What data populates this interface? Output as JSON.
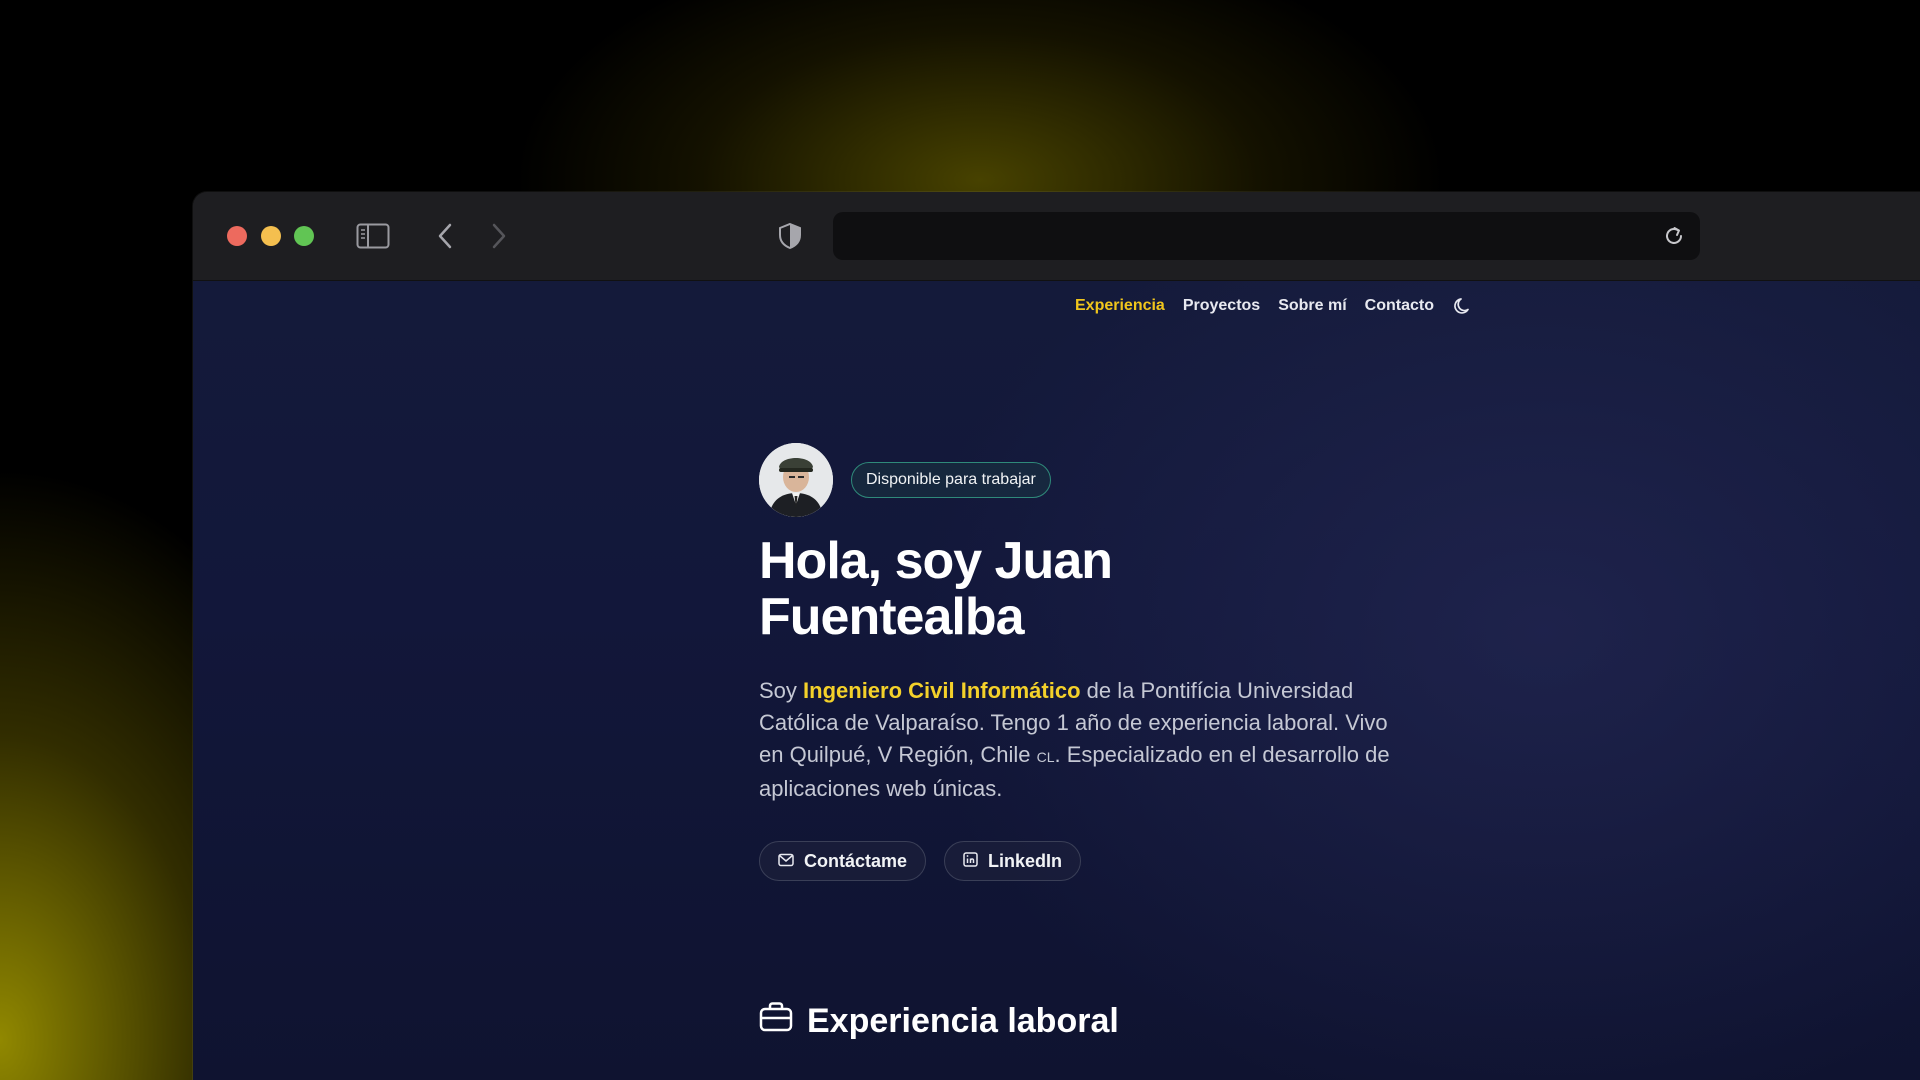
{
  "browser": {
    "address_text": ""
  },
  "site": {
    "nav": [
      {
        "label": "Experiencia",
        "active": true
      },
      {
        "label": "Proyectos",
        "active": false
      },
      {
        "label": "Sobre mí",
        "active": false
      },
      {
        "label": "Contacto",
        "active": false
      }
    ],
    "theme_toggle_icon": "moon-icon"
  },
  "hero": {
    "badge": "Disponible para trabajar",
    "title_line1": "Hola, soy Juan",
    "title_line2": "Fuentealba",
    "intro_prefix": "Soy ",
    "intro_highlight": "Ingeniero Civil Informático",
    "intro_rest": " de la Pontifícia Universidad Católica de Valparaíso. Tengo 1 año de experiencia laboral. Vivo en Quilpué, V Región, Chile ",
    "intro_flag": "CL",
    "intro_tail": ". Especializado en el desarrollo de aplicaciones web únicas.",
    "buttons": [
      {
        "label": "Contáctame",
        "icon": "mail-icon"
      },
      {
        "label": "LinkedIn",
        "icon": "linkedin-icon"
      }
    ]
  },
  "sections": {
    "experience_title": "Experiencia laboral",
    "experience_icon": "briefcase-icon"
  },
  "colors": {
    "accent": "#f0c51c",
    "highlight": "#f4d12a",
    "badge_border": "#2f8a7a",
    "page_bg": "#12173a"
  }
}
